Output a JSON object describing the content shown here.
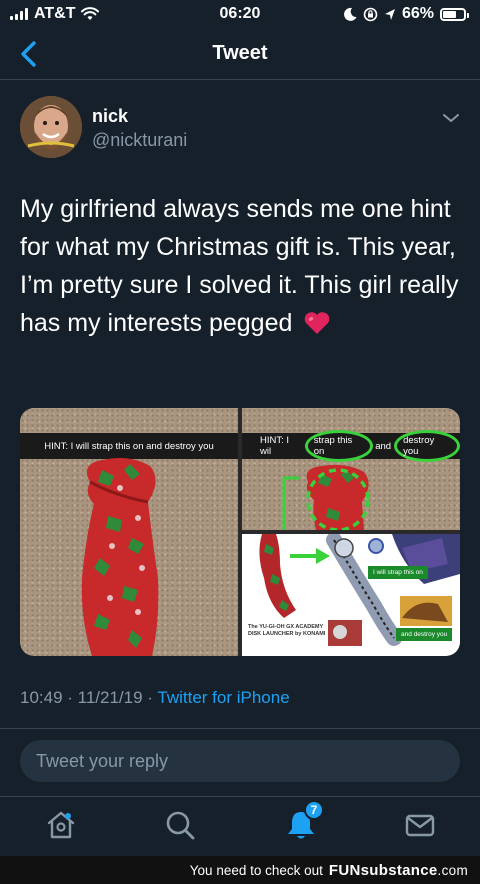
{
  "status_bar": {
    "carrier": "AT&T",
    "time": "06:20",
    "battery": "66%",
    "battery_level": 0.66
  },
  "nav": {
    "title": "Tweet"
  },
  "tweet": {
    "author_name": "nick",
    "author_handle": "@nickturani",
    "text": "My girlfriend always sends me one hint for what my Christmas gift is. This year, I’m pretty sure I solved it. This girl really has my interests pegged",
    "timestamp": "10:49 · 11/21/19 · ",
    "source": "Twitter for iPhone"
  },
  "media": {
    "hint_full": "HINT: I will strap this on and destroy you",
    "hint_prefix": "HINT: I wil",
    "hint_circle1": "strap this on",
    "hint_mid": "and",
    "hint_circle2": "destroy you",
    "caption_strap": "I will strap this on",
    "caption_destroy": "and destroy you",
    "caption_launcher": "The YU-GI-OH GX ACADEMY DISK LAUNCHER by KONAMI"
  },
  "reply": {
    "placeholder": "Tweet your reply"
  },
  "tabs": {
    "notifications_count": "7"
  },
  "watermark": {
    "text": "You need to check out",
    "brand_main": "FUN",
    "brand_sub": "substance",
    "brand_tld": ".com"
  },
  "colors": {
    "background": "#15202b",
    "accent": "#1da1f2",
    "secondary_text": "#8899a6",
    "heart": "#e0245e"
  }
}
